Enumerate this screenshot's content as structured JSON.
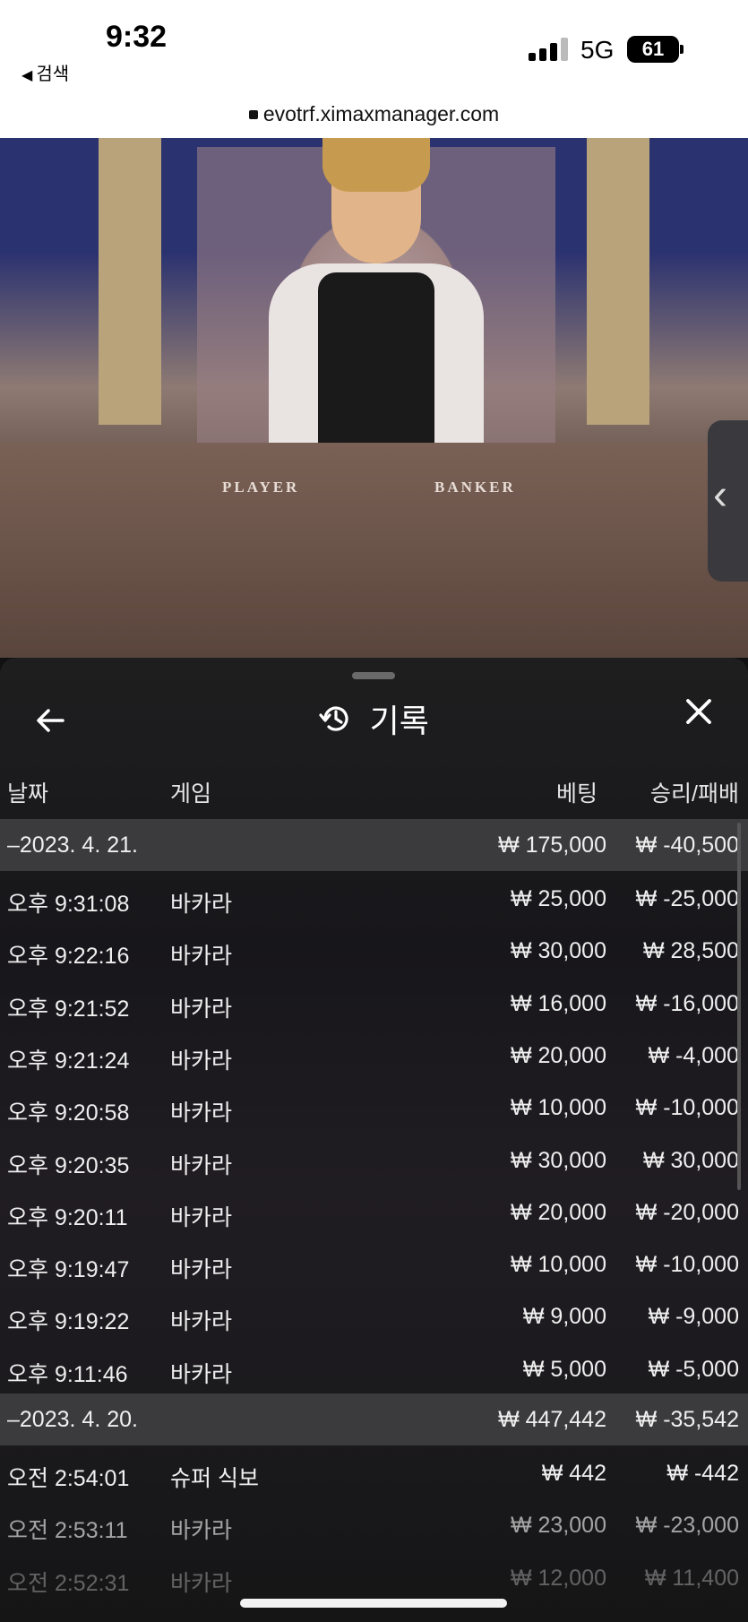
{
  "status_bar": {
    "time": "9:32",
    "back_label": "검색",
    "network": "5G",
    "battery": "61"
  },
  "browser": {
    "url": "evotrf.ximaxmanager.com"
  },
  "video": {
    "table_left_label": "PLAYER",
    "table_right_label": "BANKER"
  },
  "history": {
    "title": "기록",
    "columns": {
      "date": "날짜",
      "game": "게임",
      "bet": "베팅",
      "result": "승리/패배"
    },
    "groups": [
      {
        "date": "–2023. 4. 21.",
        "total_bet": "₩ 175,000",
        "total_result": "₩ -40,500",
        "rows": [
          {
            "time": "오후 9:31:08",
            "game": "바카라",
            "bet": "₩ 25,000",
            "result": "₩ -25,000"
          },
          {
            "time": "오후 9:22:16",
            "game": "바카라",
            "bet": "₩ 30,000",
            "result": "₩ 28,500"
          },
          {
            "time": "오후 9:21:52",
            "game": "바카라",
            "bet": "₩ 16,000",
            "result": "₩ -16,000"
          },
          {
            "time": "오후 9:21:24",
            "game": "바카라",
            "bet": "₩ 20,000",
            "result": "₩ -4,000"
          },
          {
            "time": "오후 9:20:58",
            "game": "바카라",
            "bet": "₩ 10,000",
            "result": "₩ -10,000"
          },
          {
            "time": "오후 9:20:35",
            "game": "바카라",
            "bet": "₩ 30,000",
            "result": "₩ 30,000"
          },
          {
            "time": "오후 9:20:11",
            "game": "바카라",
            "bet": "₩ 20,000",
            "result": "₩ -20,000"
          },
          {
            "time": "오후 9:19:47",
            "game": "바카라",
            "bet": "₩ 10,000",
            "result": "₩ -10,000"
          },
          {
            "time": "오후 9:19:22",
            "game": "바카라",
            "bet": "₩ 9,000",
            "result": "₩ -9,000"
          },
          {
            "time": "오후 9:11:46",
            "game": "바카라",
            "bet": "₩ 5,000",
            "result": "₩ -5,000"
          }
        ]
      },
      {
        "date": "–2023. 4. 20.",
        "total_bet": "₩ 447,442",
        "total_result": "₩ -35,542",
        "rows": [
          {
            "time": "오전 2:54:01",
            "game": "슈퍼 식보",
            "bet": "₩ 442",
            "result": "₩ -442"
          },
          {
            "time": "오전 2:53:11",
            "game": "바카라",
            "bet": "₩ 23,000",
            "result": "₩ -23,000"
          },
          {
            "time": "오전 2:52:31",
            "game": "바카라",
            "bet": "₩ 12,000",
            "result": "₩ 11,400"
          }
        ]
      }
    ]
  }
}
